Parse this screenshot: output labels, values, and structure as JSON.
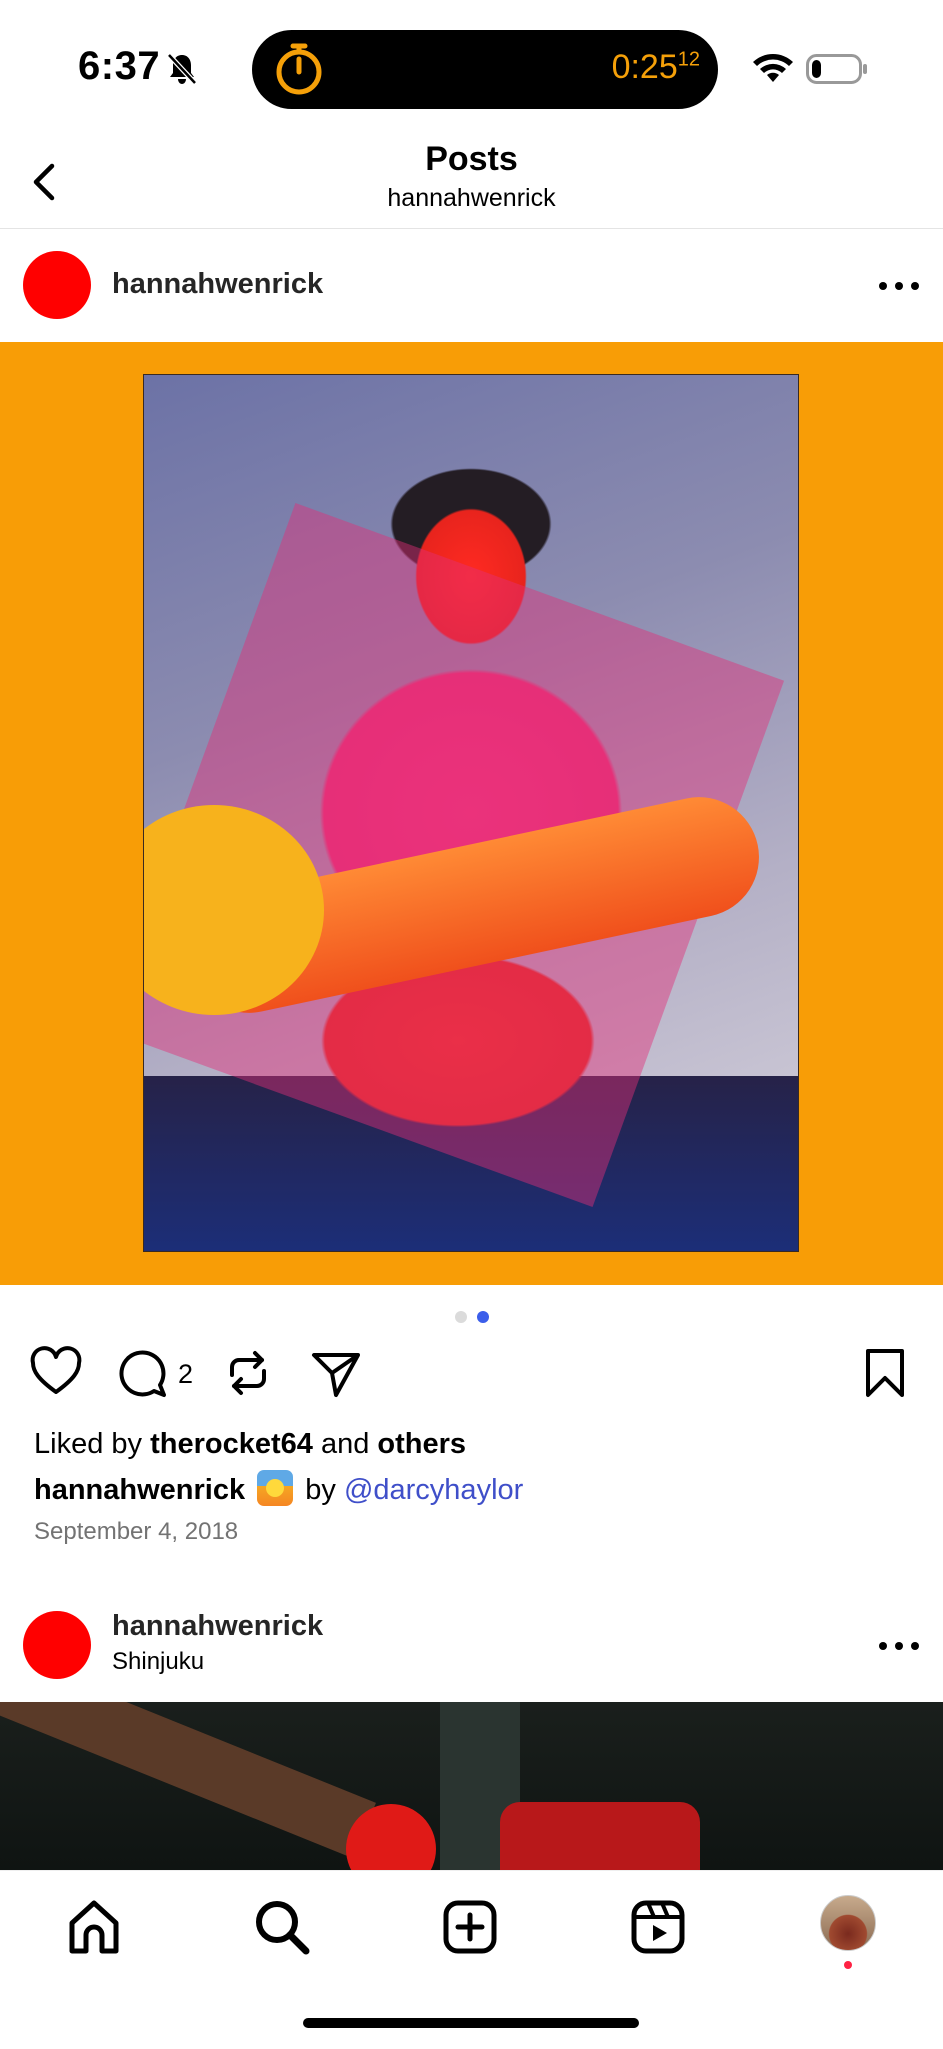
{
  "status_bar": {
    "time": "6:37",
    "timer": "0:25",
    "timer_fraction": "12",
    "battery_level": 0.2
  },
  "header": {
    "title": "Posts",
    "subtitle": "hannahwenrick"
  },
  "post1": {
    "username": "hannahwenrick",
    "carousel": {
      "count": 2,
      "active_index": 1
    },
    "comment_count": "2",
    "likes": {
      "prefix": "Liked by",
      "user": "therocket64",
      "joiner": "and",
      "others": "others"
    },
    "caption": {
      "username": "hannahwenrick",
      "by": "by",
      "mention": "@darcyhaylor"
    },
    "date": "September 4, 2018"
  },
  "post2": {
    "username": "hannahwenrick",
    "location": "Shinjuku"
  },
  "tab_bar": {
    "items": [
      "home-icon",
      "search-icon",
      "create-icon",
      "reels-icon",
      "profile-avatar"
    ]
  },
  "colors": {
    "accent_blue": "#3b5eea",
    "mention": "#3f4fc9",
    "photo_border": "#f89d06",
    "timer": "#f5a009",
    "avatar": "#ff0000"
  }
}
